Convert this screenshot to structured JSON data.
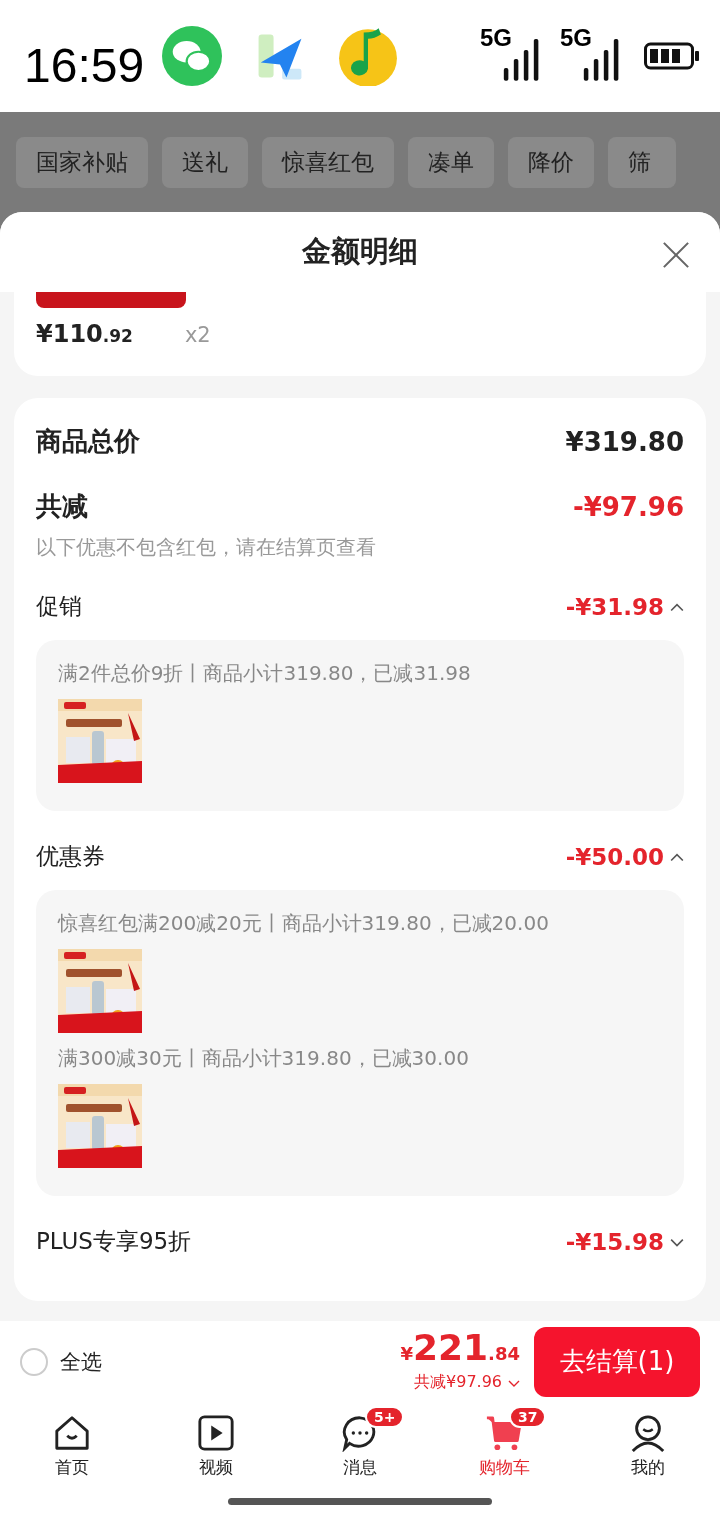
{
  "status_bar": {
    "time": "16:59",
    "signals": [
      "5G",
      "5G"
    ]
  },
  "filter_chips": [
    "国家补贴",
    "送礼",
    "惊喜红包",
    "凑单",
    "降价",
    "筛"
  ],
  "sheet": {
    "title": "金额明细",
    "item": {
      "price_main": "¥110",
      "price_decimal": ".92",
      "quantity": "x2"
    },
    "total": {
      "label": "商品总价",
      "value": "¥319.80"
    },
    "reduction": {
      "label": "共减",
      "value": "-¥97.96",
      "note": "以下优惠不包含红包，请在结算页查看"
    },
    "sections": [
      {
        "label": "促销",
        "value": "-¥31.98",
        "expanded": true,
        "rules": [
          {
            "text": "满2件总价9折丨商品小计319.80，已减31.98",
            "kind": "picture"
          }
        ]
      },
      {
        "label": "优惠券",
        "value": "-¥50.00",
        "expanded": true,
        "rules": [
          {
            "text": "惊喜红包满200减20元丨商品小计319.80，已减20.00",
            "kind": "picture"
          },
          {
            "text": "满300减30元丨商品小计319.80，已减30.00",
            "kind": "picture"
          }
        ]
      },
      {
        "label": "PLUS专享95折",
        "value": "-¥15.98",
        "expanded": false
      }
    ]
  },
  "checkout": {
    "select_all": {
      "label": "全选",
      "checked": false
    },
    "currency": "¥",
    "amount_main": "221",
    "amount_decimal": ".84",
    "saved": "共减¥97.96",
    "button": "去结算(1)"
  },
  "tabs": [
    {
      "label": "首页",
      "kind": "home",
      "selected": false
    },
    {
      "label": "视频",
      "kind": "video",
      "selected": false
    },
    {
      "label": "消息",
      "kind": "message",
      "selected": false,
      "badge": "5+"
    },
    {
      "label": "购物车",
      "kind": "cart",
      "selected": true,
      "badge": "37"
    },
    {
      "label": "我的",
      "kind": "profile",
      "selected": false
    }
  ]
}
